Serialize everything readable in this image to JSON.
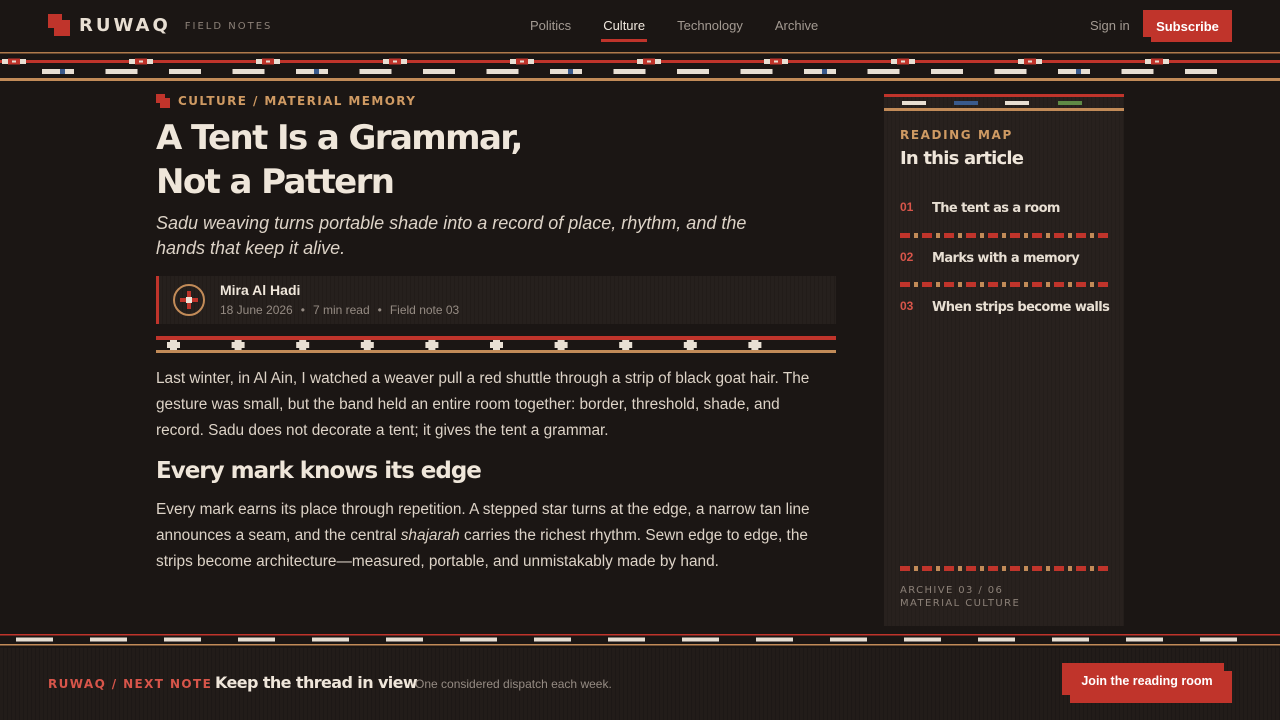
{
  "header": {
    "logo": "RUWAQ",
    "logo_sub": "FIELD NOTES",
    "nav": [
      {
        "label": "Politics",
        "active": false
      },
      {
        "label": "Culture",
        "active": true
      },
      {
        "label": "Technology",
        "active": false
      },
      {
        "label": "Archive",
        "active": false
      }
    ],
    "sign_in": "Sign in",
    "subscribe": "Subscribe"
  },
  "article": {
    "kicker": "CULTURE / MATERIAL MEMORY",
    "title_line1": "A Tent Is a Grammar,",
    "title_line2": "Not a Pattern",
    "dek": "Sadu weaving turns portable shade into a record of place, rhythm, and the hands that keep it alive.",
    "author": "Mira Al Hadi",
    "date": "18 June 2026",
    "read_time": "7 min read",
    "field_note": "Field note 03",
    "paragraph1": "Last winter, in Al Ain, I watched a weaver pull a red shuttle through a strip of black goat hair. The gesture was small, but the band held an entire room together: border, threshold, shade, and record. Sadu does not decorate a tent; it gives the tent a grammar.",
    "heading2": "Every mark knows its edge",
    "paragraph2_a": "Every mark earns its place through repetition. A stepped star turns at the edge, a narrow tan line announces a seam, and the central ",
    "paragraph2_em": "shajarah",
    "paragraph2_b": " carries the richest rhythm. Sewn edge to edge, the strips become architecture—measured, portable, and unmistakably made by hand."
  },
  "sidebar": {
    "label": "READING MAP",
    "title": "In this article",
    "toc": [
      {
        "num": "01",
        "label": "The tent as a room"
      },
      {
        "num": "02",
        "label": "Marks with a memory"
      },
      {
        "num": "03",
        "label": "When strips become walls"
      }
    ],
    "footer_line1": "ARCHIVE 03 / 06",
    "footer_line2": "MATERIAL CULTURE"
  },
  "footer": {
    "kicker": "RUWAQ / NEXT NOTE",
    "title": "Keep the thread in view",
    "subtitle": "One considered dispatch each week.",
    "cta": "Join the reading room"
  },
  "colors": {
    "background": "#1b1614",
    "accent_red": "#c0342b",
    "accent_tan": "#cf9a63",
    "text": "#e6ddd2"
  }
}
